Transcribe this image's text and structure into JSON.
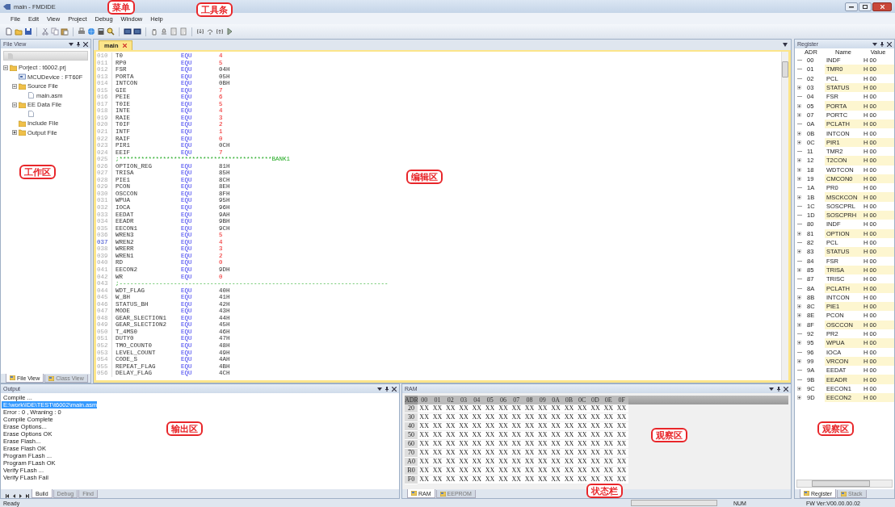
{
  "window": {
    "title": "main - FMDIDE"
  },
  "menu": [
    {
      "label": "File"
    },
    {
      "label": "Edit"
    },
    {
      "label": "View"
    },
    {
      "label": "Project"
    },
    {
      "label": "Debug"
    },
    {
      "label": "Window"
    },
    {
      "label": "Help"
    }
  ],
  "file_view": {
    "title": "File View",
    "tree": [
      {
        "label": "Porject : t6002.prj",
        "kind": "project",
        "expanded": true,
        "children": [
          {
            "label": "MCUDevice : FT60F",
            "kind": "device"
          },
          {
            "label": "Source File",
            "kind": "folder",
            "expanded": true,
            "children": [
              {
                "label": "main.asm",
                "kind": "file"
              }
            ]
          },
          {
            "label": "EE Data File",
            "kind": "folder",
            "expanded": true,
            "children": [
              {
                "kind": "file"
              }
            ]
          },
          {
            "label": "Include File",
            "kind": "folder"
          },
          {
            "label": "Output File",
            "kind": "folder",
            "expanded": false
          }
        ]
      }
    ],
    "tabs": [
      {
        "label": "File View",
        "selected": true
      },
      {
        "label": "Class View",
        "selected": false
      }
    ]
  },
  "editor": {
    "tabs": [
      {
        "label": "main",
        "selected": true
      }
    ],
    "lines": [
      {
        "num": "010",
        "kind": "bit",
        "name": "T0",
        "op": "EQU",
        "value": "4",
        "current": false
      },
      {
        "num": "011",
        "kind": "bit",
        "name": "RP0",
        "op": "EQU",
        "value": "5",
        "current": false
      },
      {
        "num": "012",
        "kind": "hex",
        "name": "FSR",
        "op": "EQU",
        "value": "04H",
        "current": false
      },
      {
        "num": "013",
        "kind": "hex",
        "name": "PORTA",
        "op": "EQU",
        "value": "05H",
        "current": false
      },
      {
        "num": "014",
        "kind": "hex",
        "name": "INTCON",
        "op": "EQU",
        "value": "0BH",
        "current": false
      },
      {
        "num": "015",
        "kind": "bit",
        "name": "GIE",
        "op": "EQU",
        "value": "7",
        "current": false
      },
      {
        "num": "016",
        "kind": "bit",
        "name": "PEIE",
        "op": "EQU",
        "value": "6",
        "current": false
      },
      {
        "num": "017",
        "kind": "bit",
        "name": "T0IE",
        "op": "EQU",
        "value": "5",
        "current": false
      },
      {
        "num": "018",
        "kind": "bit",
        "name": "INTE",
        "op": "EQU",
        "value": "4",
        "current": false
      },
      {
        "num": "019",
        "kind": "bit",
        "name": "RAIE",
        "op": "EQU",
        "value": "3",
        "current": false
      },
      {
        "num": "020",
        "kind": "bit",
        "name": "T0IF",
        "op": "EQU",
        "value": "2",
        "current": false
      },
      {
        "num": "021",
        "kind": "bit",
        "name": "INTF",
        "op": "EQU",
        "value": "1",
        "current": false
      },
      {
        "num": "022",
        "kind": "bit",
        "name": "RAIF",
        "op": "EQU",
        "value": "0",
        "current": false
      },
      {
        "num": "023",
        "kind": "hex",
        "name": "PIR1",
        "op": "EQU",
        "value": "0CH",
        "current": false
      },
      {
        "num": "024",
        "kind": "bit",
        "name": "EEIF",
        "op": "EQU",
        "value": "7",
        "current": false
      },
      {
        "num": "025",
        "kind": "comment",
        "text": ";******************************************BANK1",
        "current": false
      },
      {
        "num": "026",
        "kind": "hex",
        "name": "OPTION_REG",
        "op": "EQU",
        "value": "81H",
        "current": false
      },
      {
        "num": "027",
        "kind": "hex",
        "name": "TRISA",
        "op": "EQU",
        "value": "85H",
        "current": false
      },
      {
        "num": "028",
        "kind": "hex",
        "name": "PIE1",
        "op": "EQU",
        "value": "8CH",
        "current": false
      },
      {
        "num": "029",
        "kind": "hex",
        "name": "PCON",
        "op": "EQU",
        "value": "8EH",
        "current": false
      },
      {
        "num": "030",
        "kind": "hex",
        "name": "OSCCON",
        "op": "EQU",
        "value": "8FH",
        "current": false
      },
      {
        "num": "031",
        "kind": "hex",
        "name": "WPUA",
        "op": "EQU",
        "value": "95H",
        "current": false
      },
      {
        "num": "032",
        "kind": "hex",
        "name": "IOCA",
        "op": "EQU",
        "value": "96H",
        "current": false
      },
      {
        "num": "033",
        "kind": "hex",
        "name": "EEDAT",
        "op": "EQU",
        "value": "9AH",
        "current": false
      },
      {
        "num": "034",
        "kind": "hex",
        "name": "EEADR",
        "op": "EQU",
        "value": "9BH",
        "current": false
      },
      {
        "num": "035",
        "kind": "hex",
        "name": "EECON1",
        "op": "EQU",
        "value": "9CH",
        "current": false
      },
      {
        "num": "036",
        "kind": "bit",
        "name": "WREN3",
        "op": "EQU",
        "value": "5",
        "current": false
      },
      {
        "num": "037",
        "kind": "bit",
        "name": "WREN2",
        "op": "EQU",
        "value": "4",
        "current": true
      },
      {
        "num": "038",
        "kind": "bit",
        "name": "WRERR",
        "op": "EQU",
        "value": "3",
        "current": false
      },
      {
        "num": "039",
        "kind": "bit",
        "name": "WREN1",
        "op": "EQU",
        "value": "2",
        "current": false
      },
      {
        "num": "040",
        "kind": "bit",
        "name": "RD",
        "op": "EQU",
        "value": "0",
        "current": false
      },
      {
        "num": "041",
        "kind": "hex",
        "name": "EECON2",
        "op": "EQU",
        "value": "9DH",
        "current": false
      },
      {
        "num": "042",
        "kind": "bit",
        "name": "WR",
        "op": "EQU",
        "value": "0",
        "current": false
      },
      {
        "num": "043",
        "kind": "comment",
        "text": ";--------------------------------------------------------------------------",
        "current": false
      },
      {
        "num": "044",
        "kind": "hex",
        "name": "WDT_FLAG",
        "op": "EQU",
        "value": "40H",
        "current": false
      },
      {
        "num": "045",
        "kind": "hex",
        "name": "W_BH",
        "op": "EQU",
        "value": "41H",
        "current": false
      },
      {
        "num": "046",
        "kind": "hex",
        "name": "STATUS_BH",
        "op": "EQU",
        "value": "42H",
        "current": false
      },
      {
        "num": "047",
        "kind": "hex",
        "name": "MODE",
        "op": "EQU",
        "value": "43H",
        "current": false
      },
      {
        "num": "048",
        "kind": "hex",
        "name": "GEAR_SLECTION1",
        "op": "EQU",
        "value": "44H",
        "current": false
      },
      {
        "num": "049",
        "kind": "hex",
        "name": "GEAR_SLECTION2",
        "op": "EQU",
        "value": "45H",
        "current": false
      },
      {
        "num": "050",
        "kind": "hex",
        "name": "T_4MS0",
        "op": "EQU",
        "value": "46H",
        "current": false
      },
      {
        "num": "051",
        "kind": "hex",
        "name": "DUTY0",
        "op": "EQU",
        "value": "47H",
        "current": false
      },
      {
        "num": "052",
        "kind": "hex",
        "name": "TMO_COUNT0",
        "op": "EQU",
        "value": "48H",
        "current": false
      },
      {
        "num": "053",
        "kind": "hex",
        "name": "LEVEL_COUNT",
        "op": "EQU",
        "value": "49H",
        "current": false
      },
      {
        "num": "054",
        "kind": "hex",
        "name": "CODE_S",
        "op": "EQU",
        "value": "4AH",
        "current": false
      },
      {
        "num": "055",
        "kind": "hex",
        "name": "REPEAT_FLAG",
        "op": "EQU",
        "value": "4BH",
        "current": false
      },
      {
        "num": "056",
        "kind": "hex",
        "name": "DELAY_FLAG",
        "op": "EQU",
        "value": "4CH",
        "current": false
      }
    ]
  },
  "register": {
    "title": "Register",
    "columns": [
      "ADR",
      "Name",
      "Value"
    ],
    "rows": [
      {
        "adr": "00",
        "name": "INDF",
        "value": "H 00",
        "expandable": false
      },
      {
        "adr": "01",
        "name": "TMR0",
        "value": "H 00",
        "expandable": false
      },
      {
        "adr": "02",
        "name": "PCL",
        "value": "H 00",
        "expandable": false
      },
      {
        "adr": "03",
        "name": "STATUS",
        "value": "H 00",
        "expandable": true
      },
      {
        "adr": "04",
        "name": "FSR",
        "value": "H 00",
        "expandable": false
      },
      {
        "adr": "05",
        "name": "PORTA",
        "value": "H 00",
        "expandable": true
      },
      {
        "adr": "07",
        "name": "PORTC",
        "value": "H 00",
        "expandable": true
      },
      {
        "adr": "0A",
        "name": "PCLATH",
        "value": "H 00",
        "expandable": false
      },
      {
        "adr": "0B",
        "name": "INTCON",
        "value": "H 00",
        "expandable": true
      },
      {
        "adr": "0C",
        "name": "PIR1",
        "value": "H 00",
        "expandable": true
      },
      {
        "adr": "11",
        "name": "TMR2",
        "value": "H 00",
        "expandable": false
      },
      {
        "adr": "12",
        "name": "T2CON",
        "value": "H 00",
        "expandable": true
      },
      {
        "adr": "18",
        "name": "WDTCON",
        "value": "H 00",
        "expandable": true
      },
      {
        "adr": "19",
        "name": "CMCON0",
        "value": "H 00",
        "expandable": true
      },
      {
        "adr": "1A",
        "name": "PR0",
        "value": "H 00",
        "expandable": false
      },
      {
        "adr": "1B",
        "name": "MSCKCON",
        "value": "H 00",
        "expandable": true
      },
      {
        "adr": "1C",
        "name": "SOSCPRL",
        "value": "H 00",
        "expandable": false
      },
      {
        "adr": "1D",
        "name": "SOSCPRH",
        "value": "H 00",
        "expandable": false
      },
      {
        "adr": "80",
        "name": "INDF",
        "value": "H 00",
        "expandable": false
      },
      {
        "adr": "81",
        "name": "OPTION",
        "value": "H 00",
        "expandable": true
      },
      {
        "adr": "82",
        "name": "PCL",
        "value": "H 00",
        "expandable": false
      },
      {
        "adr": "83",
        "name": "STATUS",
        "value": "H 00",
        "expandable": true
      },
      {
        "adr": "84",
        "name": "FSR",
        "value": "H 00",
        "expandable": false
      },
      {
        "adr": "85",
        "name": "TRISA",
        "value": "H 00",
        "expandable": true
      },
      {
        "adr": "87",
        "name": "TRISC",
        "value": "H 00",
        "expandable": false
      },
      {
        "adr": "8A",
        "name": "PCLATH",
        "value": "H 00",
        "expandable": false
      },
      {
        "adr": "8B",
        "name": "INTCON",
        "value": "H 00",
        "expandable": true
      },
      {
        "adr": "8C",
        "name": "PIE1",
        "value": "H 00",
        "expandable": true
      },
      {
        "adr": "8E",
        "name": "PCON",
        "value": "H 00",
        "expandable": true
      },
      {
        "adr": "8F",
        "name": "OSCCON",
        "value": "H 00",
        "expandable": true
      },
      {
        "adr": "92",
        "name": "PR2",
        "value": "H 00",
        "expandable": false
      },
      {
        "adr": "95",
        "name": "WPUA",
        "value": "H 00",
        "expandable": true
      },
      {
        "adr": "96",
        "name": "IOCA",
        "value": "H 00",
        "expandable": false
      },
      {
        "adr": "99",
        "name": "VRCON",
        "value": "H 00",
        "expandable": true
      },
      {
        "adr": "9A",
        "name": "EEDAT",
        "value": "H 00",
        "expandable": false
      },
      {
        "adr": "9B",
        "name": "EEADR",
        "value": "H 00",
        "expandable": false
      },
      {
        "adr": "9C",
        "name": "EECON1",
        "value": "H 00",
        "expandable": true
      },
      {
        "adr": "9D",
        "name": "EECON2",
        "value": "H 00",
        "expandable": true
      }
    ],
    "tabs": [
      {
        "label": "Register",
        "selected": true
      },
      {
        "label": "Stack",
        "selected": false
      }
    ]
  },
  "output": {
    "title": "Output",
    "lines": [
      {
        "text": "Compile ...",
        "selected": false
      },
      {
        "text": "E:\\work\\IDE\\TEST\\t6002\\main.asm",
        "selected": true
      },
      {
        "text": "Error :   0 , Wraning :   0",
        "selected": false
      },
      {
        "text": "Compile Complete",
        "selected": false
      },
      {
        "text": "Erase Options...",
        "selected": false
      },
      {
        "text": "Erase Options OK",
        "selected": false
      },
      {
        "text": "Erase Flash...",
        "selected": false
      },
      {
        "text": "Erase Flash OK",
        "selected": false
      },
      {
        "text": "Program FLash ...",
        "selected": false
      },
      {
        "text": "Program FLash OK",
        "selected": false
      },
      {
        "text": "Verify FLash ...",
        "selected": false
      },
      {
        "text": "Verify FLash Fail",
        "selected": false
      }
    ],
    "tabs": [
      {
        "label": "Build",
        "selected": true
      },
      {
        "label": "Debug",
        "selected": false
      },
      {
        "label": "Find",
        "selected": false
      }
    ]
  },
  "ram": {
    "title": "RAM",
    "columns": [
      "ADR",
      "00",
      "01",
      "02",
      "03",
      "04",
      "05",
      "06",
      "07",
      "08",
      "09",
      "0A",
      "0B",
      "0C",
      "0D",
      "0E",
      "0F"
    ],
    "rows": [
      [
        "20",
        "XX",
        "XX",
        "XX",
        "XX",
        "XX",
        "XX",
        "XX",
        "XX",
        "XX",
        "XX",
        "XX",
        "XX",
        "XX",
        "XX",
        "XX",
        "XX"
      ],
      [
        "30",
        "XX",
        "XX",
        "XX",
        "XX",
        "XX",
        "XX",
        "XX",
        "XX",
        "XX",
        "XX",
        "XX",
        "XX",
        "XX",
        "XX",
        "XX",
        "XX"
      ],
      [
        "40",
        "XX",
        "XX",
        "XX",
        "XX",
        "XX",
        "XX",
        "XX",
        "XX",
        "XX",
        "XX",
        "XX",
        "XX",
        "XX",
        "XX",
        "XX",
        "XX"
      ],
      [
        "50",
        "XX",
        "XX",
        "XX",
        "XX",
        "XX",
        "XX",
        "XX",
        "XX",
        "XX",
        "XX",
        "XX",
        "XX",
        "XX",
        "XX",
        "XX",
        "XX"
      ],
      [
        "60",
        "XX",
        "XX",
        "XX",
        "XX",
        "XX",
        "XX",
        "XX",
        "XX",
        "XX",
        "XX",
        "XX",
        "XX",
        "XX",
        "XX",
        "XX",
        "XX"
      ],
      [
        "70",
        "XX",
        "XX",
        "XX",
        "XX",
        "XX",
        "XX",
        "XX",
        "XX",
        "XX",
        "XX",
        "XX",
        "XX",
        "XX",
        "XX",
        "XX",
        "XX"
      ],
      [
        "A0",
        "XX",
        "XX",
        "XX",
        "XX",
        "XX",
        "XX",
        "XX",
        "XX",
        "XX",
        "XX",
        "XX",
        "XX",
        "XX",
        "XX",
        "XX",
        "XX"
      ],
      [
        "B0",
        "XX",
        "XX",
        "XX",
        "XX",
        "XX",
        "XX",
        "XX",
        "XX",
        "XX",
        "XX",
        "XX",
        "XX",
        "XX",
        "XX",
        "XX",
        "XX"
      ],
      [
        "F0",
        "XX",
        "XX",
        "XX",
        "XX",
        "XX",
        "XX",
        "XX",
        "XX",
        "XX",
        "XX",
        "XX",
        "XX",
        "XX",
        "XX",
        "XX",
        "XX"
      ]
    ],
    "tabs": [
      {
        "label": "RAM",
        "selected": true
      },
      {
        "label": "EEPROM",
        "selected": false
      }
    ]
  },
  "status_bar": {
    "message": "Ready",
    "indicator": "NUM",
    "version": "FW Ver:V00.00.00.02"
  },
  "annotations": [
    {
      "label": "菜单"
    },
    {
      "label": "工具条"
    },
    {
      "label": "工作区"
    },
    {
      "label": "编辑区"
    },
    {
      "label": "输出区"
    },
    {
      "label": "观察区"
    },
    {
      "label": "观察区"
    },
    {
      "label": "状态栏"
    }
  ]
}
